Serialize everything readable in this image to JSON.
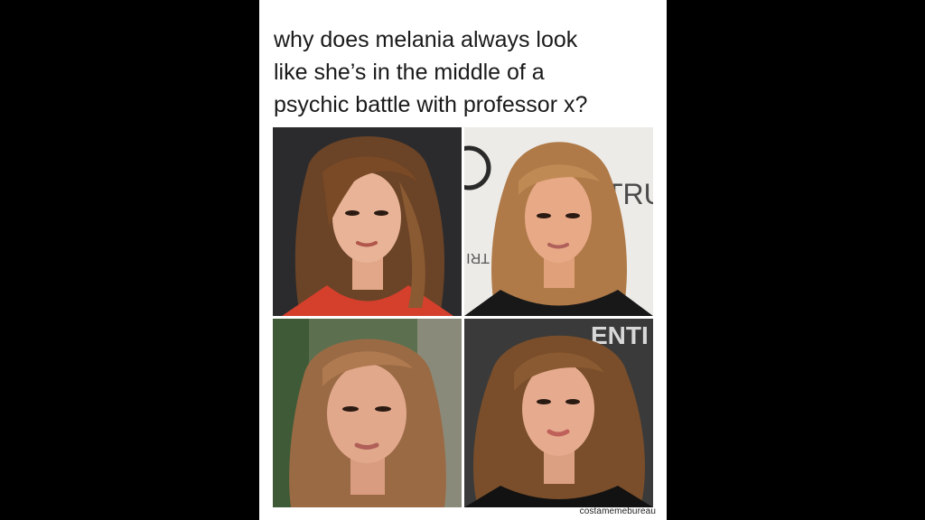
{
  "caption": {
    "lines": [
      "why does melania always look",
      "like she’s in the middle of a",
      "psychic battle with professor x?"
    ]
  },
  "photos": [
    {
      "id": "top-left",
      "background": "#2a2a2a",
      "top_color": "#d63a2a"
    },
    {
      "id": "top-right",
      "background": "#ecebe7",
      "top_color": "#1a1a1a",
      "backdrop_text": "TRU",
      "backdrop_text_mirrored": "TRI"
    },
    {
      "id": "bottom-left",
      "background": "#4f6a45",
      "top_color": "#9a7a68"
    },
    {
      "id": "bottom-right",
      "background": "#3a3a3a",
      "top_color": "#121212",
      "backdrop_text": "ENTI"
    }
  ],
  "credit": "costamemebureau"
}
